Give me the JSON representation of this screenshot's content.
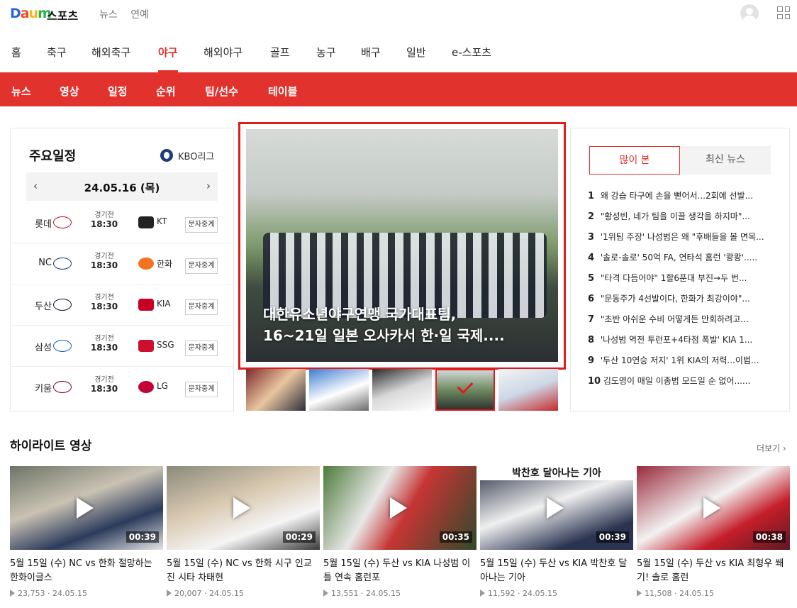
{
  "header": {
    "logo": {
      "d": "D",
      "a": "a",
      "u": "u",
      "m": "m"
    },
    "brand": "스포츠",
    "topnav": [
      "뉴스",
      "연예"
    ]
  },
  "categories": [
    "홈",
    "축구",
    "해외축구",
    "야구",
    "해외야구",
    "골프",
    "농구",
    "배구",
    "일반",
    "e-스포츠"
  ],
  "subnav": [
    "뉴스",
    "영상",
    "일정",
    "순위",
    "팀/선수",
    "테이블"
  ],
  "schedule": {
    "title": "주요일정",
    "league": "KBO리그",
    "date": "24.05.16 (목)",
    "prev": "‹",
    "next": "›",
    "games": [
      {
        "home": "롯데",
        "status": "경기전",
        "time": "18:30",
        "away": "KT",
        "button": "문자중계"
      },
      {
        "home": "NC",
        "status": "경기전",
        "time": "18:30",
        "away": "한화",
        "button": "문자중계"
      },
      {
        "home": "두산",
        "status": "경기전",
        "time": "18:30",
        "away": "KIA",
        "button": "문자중계"
      },
      {
        "home": "삼성",
        "status": "경기전",
        "time": "18:30",
        "away": "SSG",
        "button": "문자중계"
      },
      {
        "home": "키움",
        "status": "경기전",
        "time": "18:30",
        "away": "LG",
        "button": "문자중계"
      }
    ]
  },
  "hero": {
    "caption_line1": "대한유소년야구연맹 국가대표팀,",
    "caption_line2": "16~21일 일본 오사카서 한·일 국제....",
    "thumbs": 5,
    "selected_thumb": 4
  },
  "ranking": {
    "tab_active": "많이 본",
    "tab_inactive": "최신 뉴스",
    "items": [
      {
        "n": "1",
        "t": "왜 강습 타구에 손을 뻗어서...2회에 선발..."
      },
      {
        "n": "2",
        "t": "\"황성빈, 네가 팀을 이끌 생각을 하지마\"..."
      },
      {
        "n": "3",
        "t": "'1위팀 주장' 나성범은 왜 \"후배들을 볼 면목..."
      },
      {
        "n": "4",
        "t": "'솔로-솔로' 50억 FA, 연타석 홈런 '쾅쾅'....."
      },
      {
        "n": "5",
        "t": "\"타격 다듬어야\" 1할6푼대 부진→두 번..."
      },
      {
        "n": "6",
        "t": "\"문동주가 4선발이다, 한화가 최강이야\"..."
      },
      {
        "n": "7",
        "t": "\"초반 아쉬운 수비 어떻게든 만회하려고..."
      },
      {
        "n": "8",
        "t": "'나성범 역전 투런포+4타점 폭발' KIA 1..."
      },
      {
        "n": "9",
        "t": "'두산 10연승 저지' 1위 KIA의 저력...이범..."
      },
      {
        "n": "10",
        "t": "김도영이 매일 이종범 모드일 순 없어......"
      }
    ]
  },
  "highlight": {
    "title": "하이라이트 영상",
    "more": "더보기 ›",
    "videos": [
      {
        "title": "5월 15일 (수) NC vs 한화 절망하는 한화이글스",
        "duration": "00:39",
        "views": "23,753",
        "date": "24.05.15",
        "overlay": ""
      },
      {
        "title": "5월 15일 (수) NC vs 한화 시구 인교진 시타 차태현",
        "duration": "00:29",
        "views": "20,007",
        "date": "24.05.15",
        "overlay": ""
      },
      {
        "title": "5월 15일 (수) 두산 vs KIA 나성범 이틀 연속 홈런포",
        "duration": "00:35",
        "views": "13,551",
        "date": "24.05.15",
        "overlay": ""
      },
      {
        "title": "5월 15일 (수) 두산 vs KIA 박찬호 달아나는 기아",
        "duration": "00:39",
        "views": "11,592",
        "date": "24.05.15",
        "overlay": "박찬호 달아나는 기아"
      },
      {
        "title": "5월 15일 (수) 두산 vs KIA 최형우 쐐기! 솔로 홈런",
        "duration": "00:38",
        "views": "11,508",
        "date": "24.05.15",
        "overlay": ""
      }
    ]
  },
  "colors": {
    "accent": "#e1322d",
    "highlight_border": "#e01b1b"
  }
}
